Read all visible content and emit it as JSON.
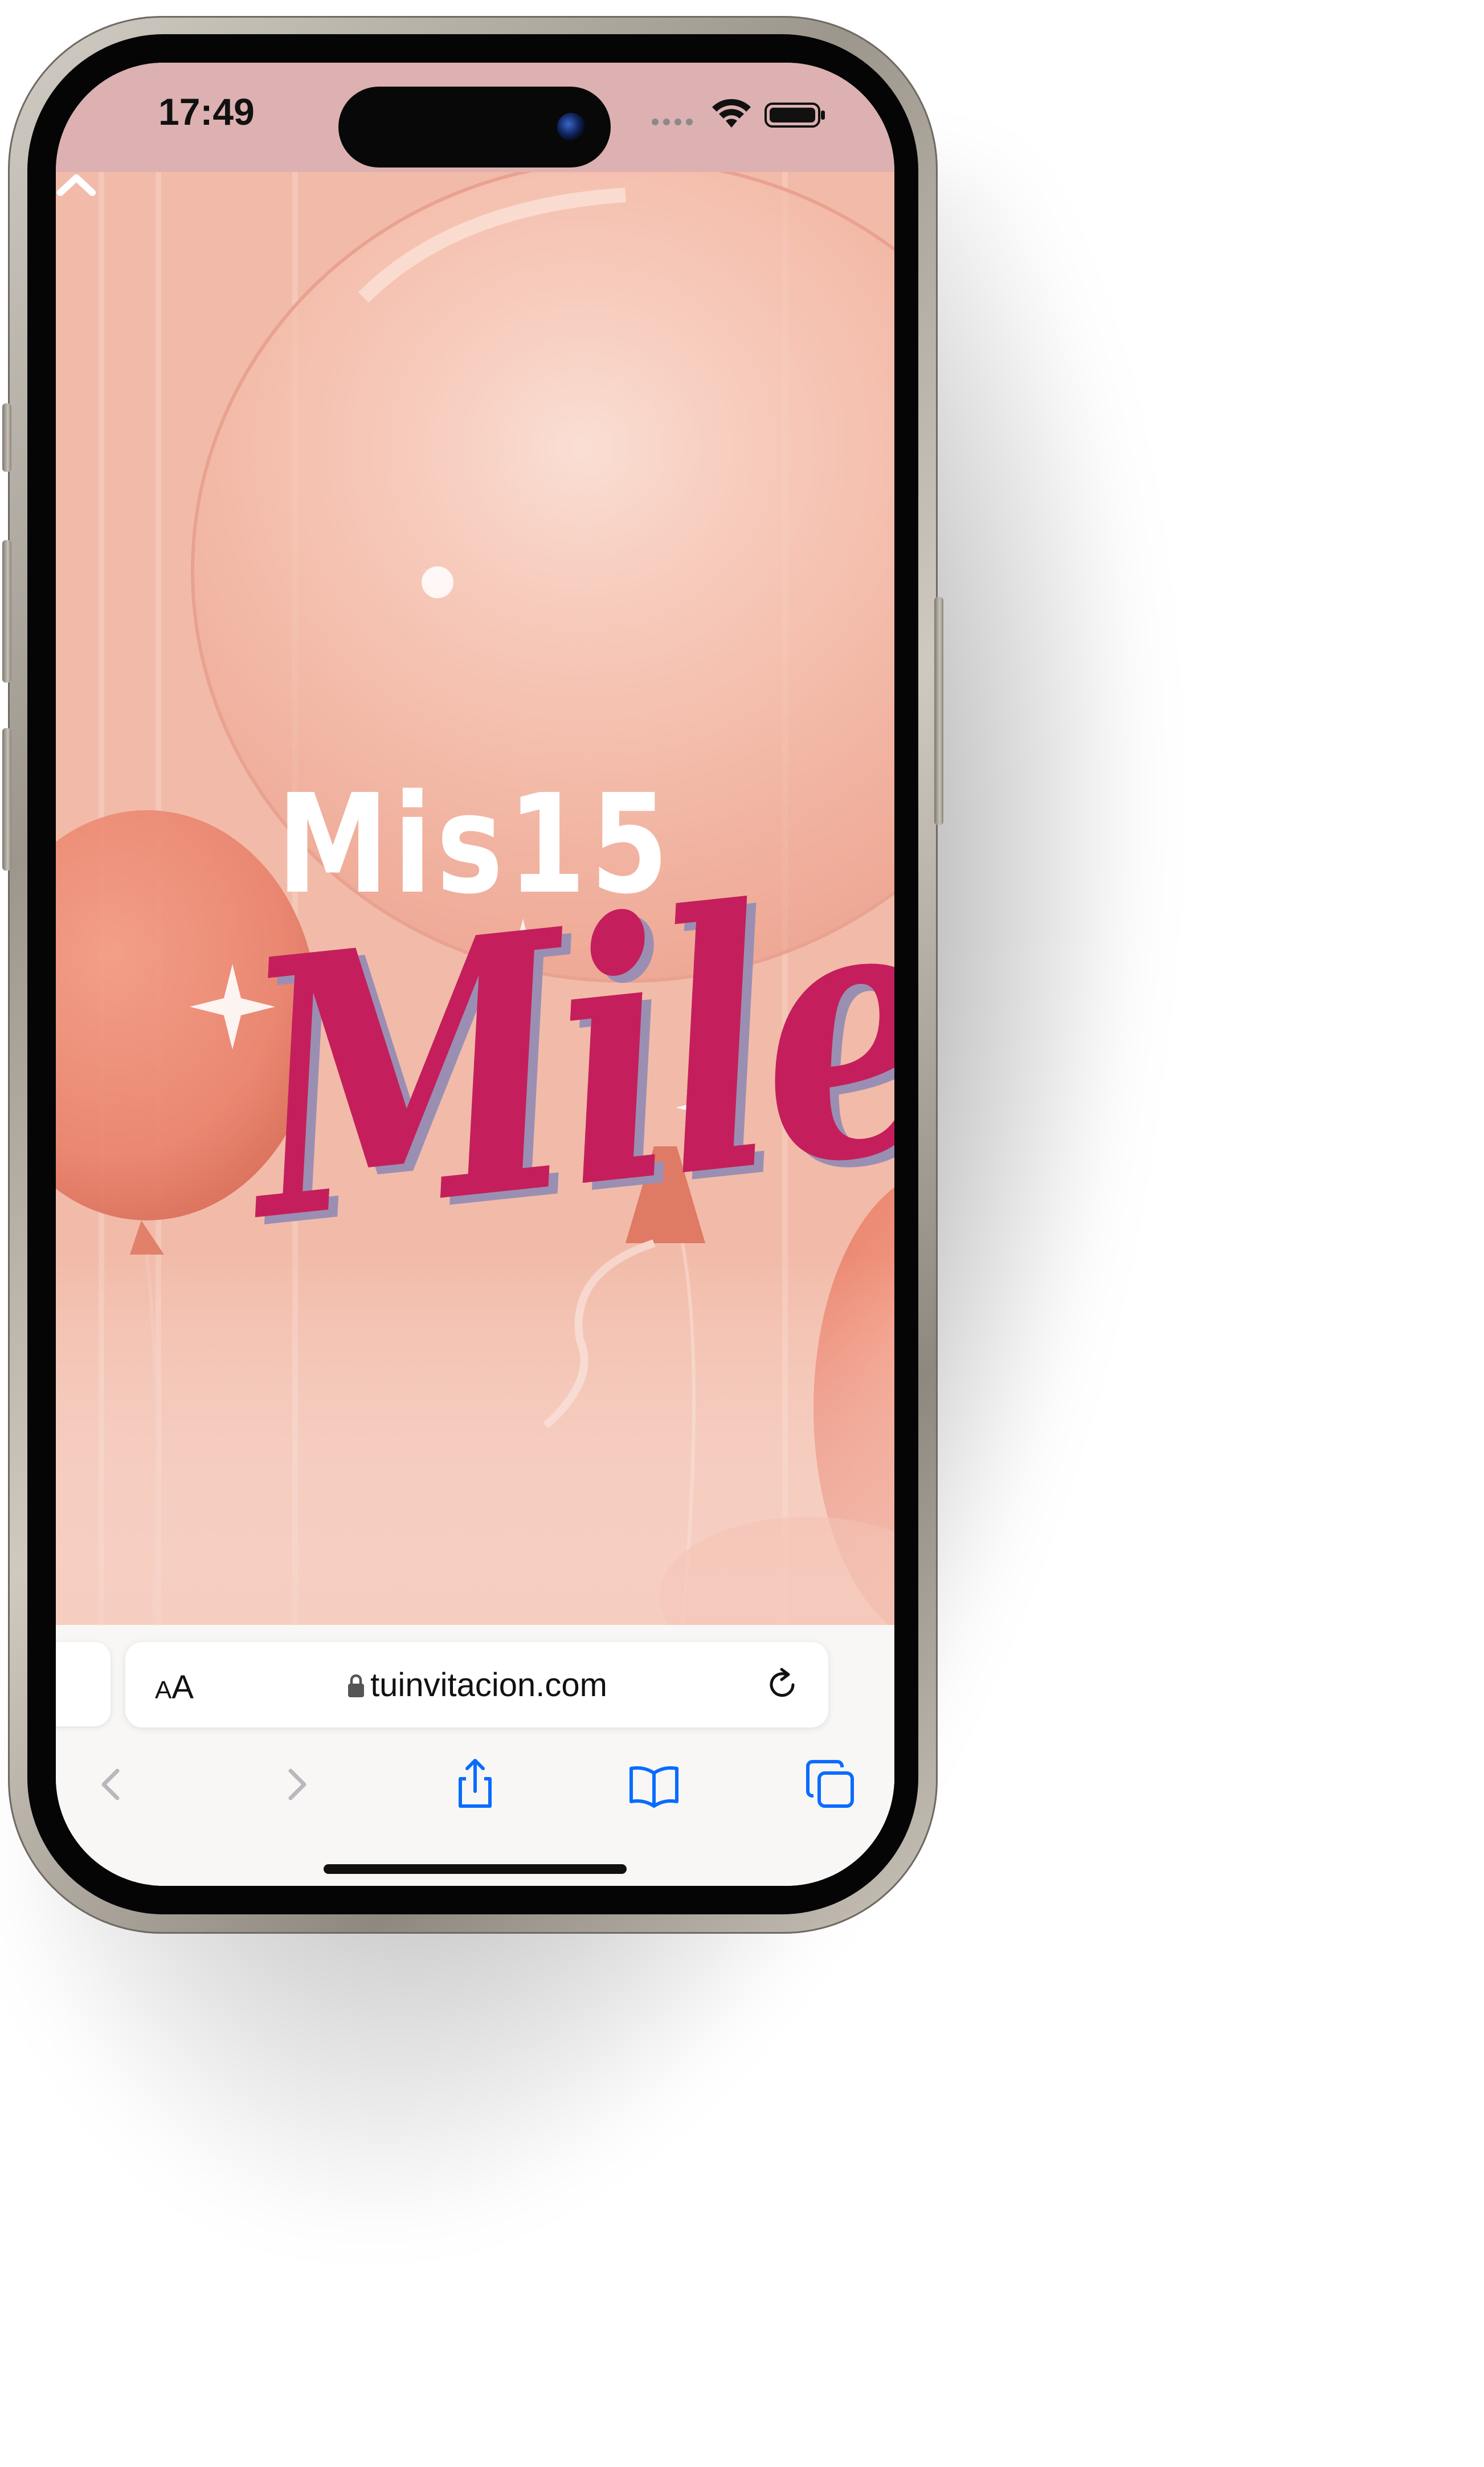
{
  "status_bar": {
    "time": "17:49",
    "icons": [
      "signal-icon",
      "wifi-icon",
      "battery-icon"
    ],
    "background": "#ddb1b1"
  },
  "hero": {
    "title": "Mis15",
    "name": "Mile",
    "name_color": "#c41f5c",
    "background": "#f3bfae",
    "balloon_color": "#e9826c",
    "scroll_icon": "chevron-up-icon"
  },
  "browser": {
    "text_size_button": {
      "small": "A",
      "large": "A"
    },
    "url": "tuinvitacion.com",
    "lock_icon": "lock-icon",
    "reload_icon": "reload-icon",
    "toolbar": {
      "back_icon": "chevron-left-icon",
      "forward_icon": "chevron-right-icon",
      "share_icon": "share-icon",
      "bookmarks_icon": "book-icon",
      "tabs_icon": "tabs-icon",
      "accent": "#0a6cff",
      "disabled": "#b8b8bd"
    }
  }
}
